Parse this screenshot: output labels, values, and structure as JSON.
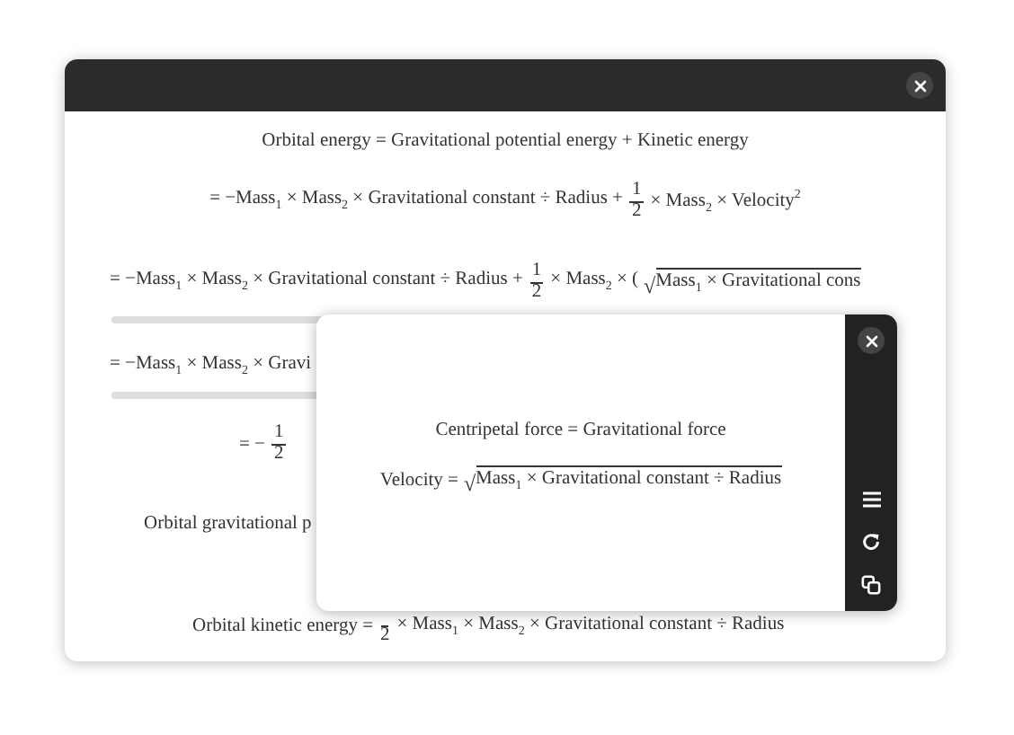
{
  "equations": [
    {
      "parts": [
        {
          "kind": "text",
          "text": "Orbital energy = Gravitational potential energy + Kinetic energy"
        }
      ]
    },
    {
      "parts": [
        {
          "kind": "text",
          "text": "= −Mass$_{1}$ × Mass$_{2}$ × Gravitational constant ÷ Radius +"
        },
        {
          "kind": "frac",
          "num": "1",
          "den": "2"
        },
        {
          "kind": "text",
          "text": "× Mass$_{2}$ × Velocity$^{2}$"
        }
      ]
    },
    {
      "parts": [
        {
          "kind": "text",
          "text": "= −Mass$_{1}$ × Mass$_{2}$ × Gravitational constant ÷ Radius +"
        },
        {
          "kind": "frac",
          "num": "1",
          "den": "2"
        },
        {
          "kind": "text",
          "text": "× Mass$_{2}$ × ("
        },
        {
          "kind": "sqrt",
          "sign": "√",
          "text": "Mass$_{1}$ × Gravitational cons"
        }
      ],
      "scrollbar": true
    },
    {
      "parts": [
        {
          "kind": "text",
          "text": "= −Mass$_{1}$ × Mass$_{2}$ × Gravi"
        }
      ],
      "scrollbar": true
    },
    {
      "parts": [
        {
          "kind": "text",
          "text": "= −"
        },
        {
          "kind": "frac",
          "num": "1",
          "den": "2"
        }
      ]
    },
    {
      "parts": [
        {
          "kind": "text",
          "text": "Orbital gravitational p"
        }
      ]
    },
    {
      "parts": [
        {
          "kind": "text",
          "text": "Orbital kinetic energy ="
        },
        {
          "kind": "frac",
          "den": "2"
        },
        {
          "kind": "text",
          "text": "× Mass$_{1}$ × Mass$_{2}$ × Gravitational constant ÷ Radius"
        }
      ]
    }
  ],
  "popup": {
    "equations": [
      {
        "parts": [
          {
            "kind": "text",
            "text": "Centripetal force = Gravitational force"
          }
        ]
      },
      {
        "parts": [
          {
            "kind": "text",
            "text": "Velocity ="
          },
          {
            "kind": "sqrt",
            "sign": "√",
            "text": "Mass$_{1}$ × Gravitational constant ÷ Radius"
          }
        ]
      }
    ],
    "tools": [
      {
        "kind": "close"
      },
      {
        "kind": "menu"
      },
      {
        "kind": "refresh"
      },
      {
        "kind": "copy"
      }
    ]
  }
}
